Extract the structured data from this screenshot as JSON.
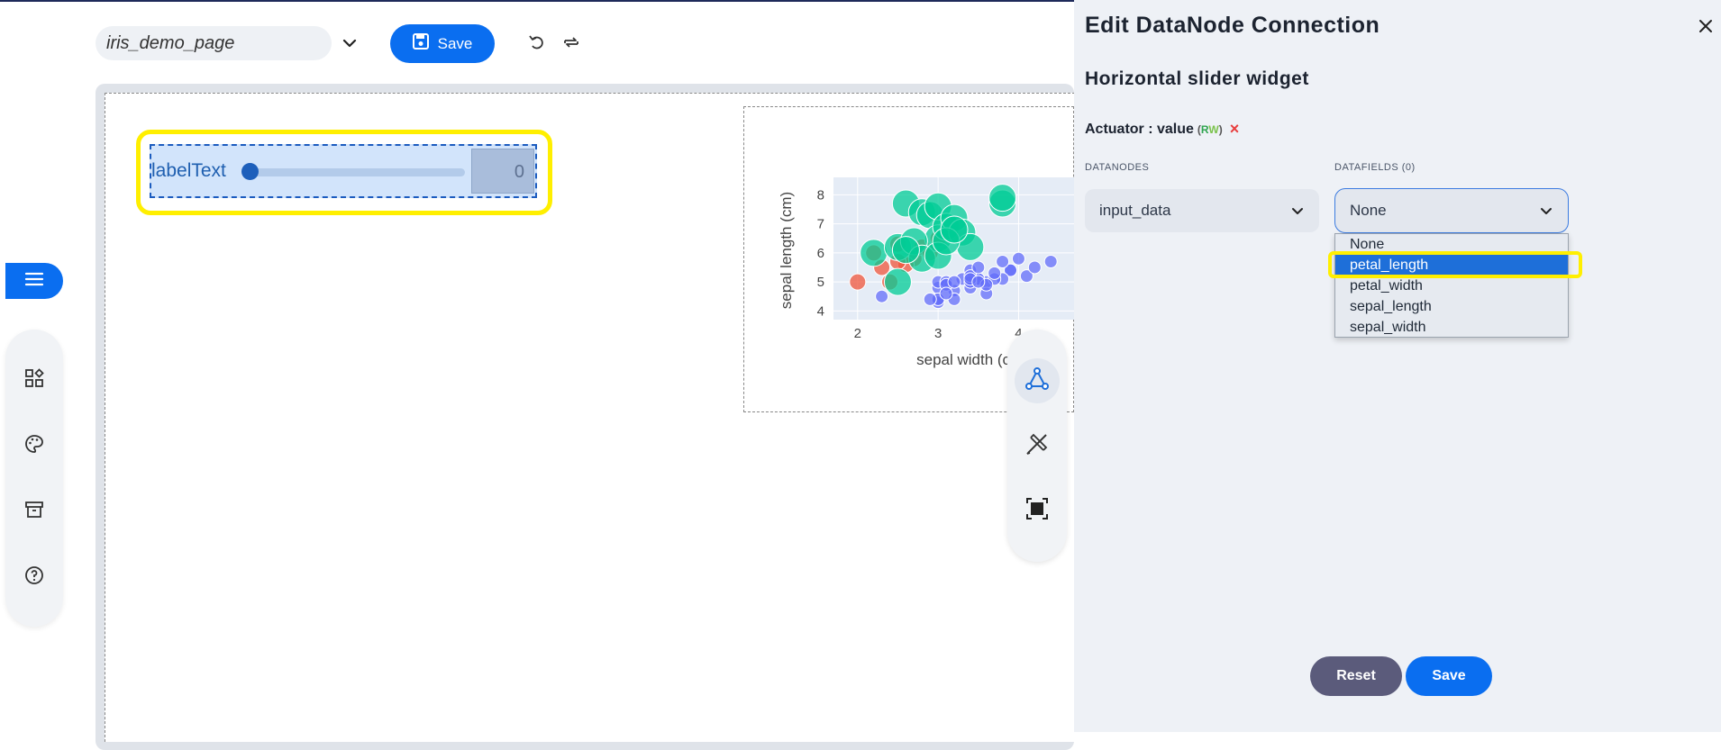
{
  "toolbar": {
    "page_name": "iris_demo_page",
    "save_label": "Save"
  },
  "slider_widget": {
    "label": "labelText",
    "value": "0",
    "position_fraction": 0
  },
  "chart_data": {
    "type": "scatter",
    "xlabel": "sepal width (cm)",
    "ylabel": "sepal length (cm)",
    "xlim": [
      1.7,
      4.7
    ],
    "ylim": [
      3.7,
      8.6
    ],
    "x_ticks": [
      "2",
      "3",
      "4"
    ],
    "y_ticks": [
      "4",
      "5",
      "6",
      "7",
      "8"
    ],
    "series": [
      {
        "color": "#ef553b",
        "points": [
          [
            2.0,
            5.0
          ],
          [
            2.3,
            5.5
          ],
          [
            2.4,
            5.0
          ],
          [
            2.5,
            6.3
          ],
          [
            2.7,
            5.8
          ],
          [
            2.8,
            6.2
          ],
          [
            2.9,
            6.0
          ],
          [
            3.0,
            6.5
          ],
          [
            2.6,
            5.6
          ],
          [
            2.2,
            6.0
          ],
          [
            2.5,
            5.7
          ]
        ]
      },
      {
        "color": "#00cc96",
        "points": [
          [
            2.2,
            6.0
          ],
          [
            2.5,
            6.2
          ],
          [
            2.6,
            7.7
          ],
          [
            2.8,
            7.4
          ],
          [
            2.9,
            7.3
          ],
          [
            3.0,
            7.6
          ],
          [
            3.0,
            6.5
          ],
          [
            3.1,
            6.9
          ],
          [
            3.2,
            7.2
          ],
          [
            3.3,
            6.7
          ],
          [
            3.4,
            6.2
          ],
          [
            3.8,
            7.7
          ],
          [
            3.8,
            7.9
          ],
          [
            2.7,
            6.4
          ],
          [
            2.8,
            5.8
          ],
          [
            3.0,
            5.9
          ],
          [
            2.6,
            6.1
          ],
          [
            3.1,
            6.4
          ],
          [
            2.5,
            5.0
          ],
          [
            3.2,
            6.8
          ]
        ]
      },
      {
        "color": "#636efa",
        "points": [
          [
            2.3,
            4.5
          ],
          [
            3.0,
            4.4
          ],
          [
            3.2,
            4.7
          ],
          [
            3.4,
            5.0
          ],
          [
            3.5,
            5.1
          ],
          [
            3.1,
            4.9
          ],
          [
            3.6,
            5.0
          ],
          [
            3.9,
            5.4
          ],
          [
            3.4,
            4.8
          ],
          [
            3.0,
            4.8
          ],
          [
            3.0,
            4.3
          ],
          [
            4.0,
            5.8
          ],
          [
            4.4,
            5.7
          ],
          [
            3.9,
            5.4
          ],
          [
            3.5,
            5.1
          ],
          [
            3.8,
            5.7
          ],
          [
            3.8,
            5.1
          ],
          [
            3.4,
            5.4
          ],
          [
            3.7,
            5.1
          ],
          [
            3.6,
            4.6
          ],
          [
            3.3,
            5.1
          ],
          [
            3.4,
            5.0
          ],
          [
            3.0,
            5.0
          ],
          [
            3.4,
            5.2
          ],
          [
            3.2,
            4.4
          ],
          [
            3.1,
            5.0
          ],
          [
            4.1,
            5.2
          ],
          [
            4.2,
            5.5
          ],
          [
            3.1,
            4.9
          ],
          [
            3.2,
            5.0
          ],
          [
            3.5,
            5.5
          ],
          [
            3.6,
            4.9
          ],
          [
            3.0,
            4.4
          ],
          [
            3.4,
            5.1
          ],
          [
            3.5,
            5.0
          ],
          [
            2.9,
            4.4
          ],
          [
            3.1,
            4.6
          ],
          [
            3.7,
            5.3
          ]
        ]
      }
    ]
  },
  "panel": {
    "title": "Edit DataNode Connection",
    "widget_name": "Horizontal slider widget",
    "actuator_label": "Actuator : value",
    "rw_r": "R",
    "rw_w": "W",
    "remove_symbol": "×",
    "datanodes_label": "DATANODES",
    "datafields_label": "DATAFIELDS (0)",
    "datanode_value": "input_data",
    "datafield_value": "None",
    "datafield_options": [
      "None",
      "petal_length",
      "petal_width",
      "sepal_length",
      "sepal_width"
    ],
    "highlighted_option": "petal_length",
    "reset_label": "Reset",
    "save_label": "Save"
  },
  "colors": {
    "accent": "#0a6ef0",
    "highlight": "#ffef00",
    "reset": "#5b5b7b"
  }
}
